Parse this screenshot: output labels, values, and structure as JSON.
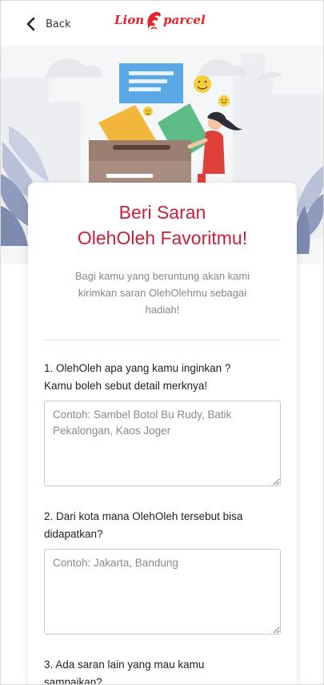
{
  "header": {
    "back_label": "Back",
    "logo_left": "Lion",
    "logo_right": "parcel"
  },
  "colors": {
    "brand_red": "#e5232d",
    "title_red": "#c8203a"
  },
  "card": {
    "title_line1": "Beri Saran",
    "title_line2": "OlehOleh Favoritmu!",
    "subtitle": "Bagi kamu yang beruntung akan kami kirimkan saran OlehOlehmu sebagai hadiah!"
  },
  "questions": [
    {
      "label_line1": "1. OlehOleh apa yang kamu inginkan ?",
      "label_line2": "Kamu boleh sebut detail merknya!",
      "placeholder": "Contoh: Sambel Botol Bu Rudy, Batik Pekalongan, Kaos Joger"
    },
    {
      "label_line1": "2. Dari kota mana OlehOleh tersebut bisa",
      "label_line2": "didapatkan?",
      "placeholder": "Contoh: Jakarta, Bandung"
    },
    {
      "label_line1": "3. Ada saran lain yang mau kamu",
      "label_line2": "sampaikan?"
    }
  ],
  "icons": [
    "chevron-left-icon",
    "lion-logo-icon"
  ]
}
